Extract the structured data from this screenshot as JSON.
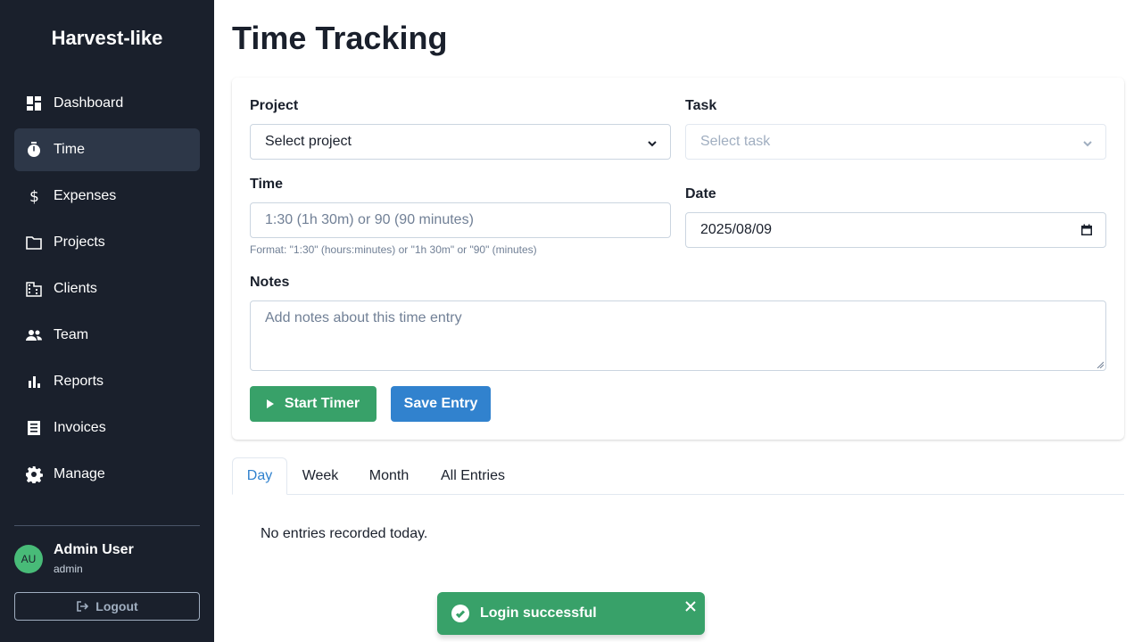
{
  "app": {
    "brand": "Harvest-like"
  },
  "sidebar": {
    "items": [
      {
        "label": "Dashboard",
        "icon": "dashboard-icon",
        "active": false
      },
      {
        "label": "Time",
        "icon": "stopwatch-icon",
        "active": true
      },
      {
        "label": "Expenses",
        "icon": "dollar-icon",
        "active": false
      },
      {
        "label": "Projects",
        "icon": "folder-icon",
        "active": false
      },
      {
        "label": "Clients",
        "icon": "building-icon",
        "active": false
      },
      {
        "label": "Team",
        "icon": "people-icon",
        "active": false
      },
      {
        "label": "Reports",
        "icon": "bar-chart-icon",
        "active": false
      },
      {
        "label": "Invoices",
        "icon": "receipt-icon",
        "active": false
      },
      {
        "label": "Manage",
        "icon": "gear-icon",
        "active": false
      }
    ],
    "user": {
      "initials": "AU",
      "name": "Admin User",
      "role": "admin"
    },
    "logout_label": "Logout"
  },
  "main": {
    "title": "Time Tracking",
    "form": {
      "project_label": "Project",
      "project_value": "Select project",
      "task_label": "Task",
      "task_value": "Select task",
      "time_label": "Time",
      "time_placeholder": "1:30 (1h 30m) or 90 (90 minutes)",
      "time_hint": "Format: \"1:30\" (hours:minutes) or \"1h 30m\" or \"90\" (minutes)",
      "date_label": "Date",
      "date_value": "2025/08/09",
      "notes_label": "Notes",
      "notes_placeholder": "Add notes about this time entry",
      "start_timer_label": "Start Timer",
      "save_entry_label": "Save Entry"
    },
    "tabs": [
      {
        "label": "Day",
        "active": true
      },
      {
        "label": "Week",
        "active": false
      },
      {
        "label": "Month",
        "active": false
      },
      {
        "label": "All Entries",
        "active": false
      }
    ],
    "empty_message": "No entries recorded today."
  },
  "toast": {
    "message": "Login successful"
  },
  "colors": {
    "sidebar_bg": "#1a202c",
    "active_item_bg": "#2d3748",
    "primary_green": "#38a169",
    "primary_blue": "#3182ce",
    "avatar_green": "#48bb78"
  }
}
